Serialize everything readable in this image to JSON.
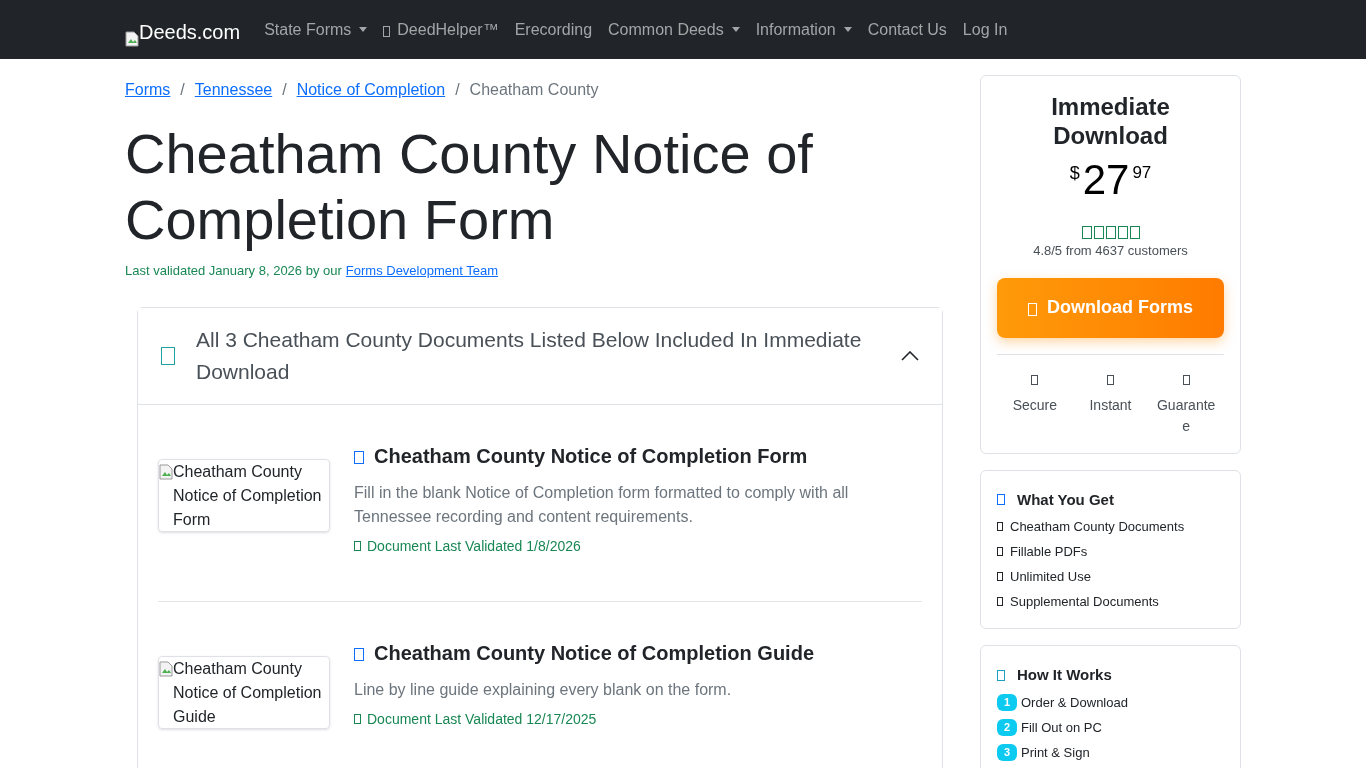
{
  "navbar": {
    "brand": "Deeds.com",
    "items": [
      {
        "label": "State Forms",
        "kind": "dropdown"
      },
      {
        "label": "DeedHelper™",
        "kind": "icon"
      },
      {
        "label": "Erecording",
        "kind": "link"
      },
      {
        "label": "Common Deeds",
        "kind": "dropdown"
      },
      {
        "label": "Information",
        "kind": "dropdown"
      },
      {
        "label": "Contact Us",
        "kind": "link"
      },
      {
        "label": "Log In",
        "kind": "link"
      }
    ]
  },
  "breadcrumb_separator": "/",
  "breadcrumb": [
    {
      "label": "Forms",
      "kind": "link"
    },
    {
      "label": "Tennessee",
      "kind": "link"
    },
    {
      "label": "Notice of Completion",
      "kind": "link"
    },
    {
      "label": "Cheatham County",
      "kind": "current"
    }
  ],
  "title": "Cheatham County Notice of Completion Form",
  "validated": {
    "text": "Last validated January 8, 2026 by our",
    "link": "Forms Development Team"
  },
  "accordion": {
    "header": "All 3 Cheatham County Documents Listed Below Included In Immediate Download",
    "expanded": true,
    "documents": [
      {
        "image_alt": "Cheatham County Notice of Completion Form",
        "title": "Cheatham County Notice of Completion Form",
        "description": "Fill in the blank Notice of Completion form formatted to comply with all Tennessee recording and content requirements.",
        "validated": "Document Last Validated 1/8/2026"
      },
      {
        "image_alt": "Cheatham County Notice of Completion Guide",
        "title": "Cheatham County Notice of Completion Guide",
        "description": "Line by line guide explaining every blank on the form.",
        "validated": "Document Last Validated 12/17/2025"
      }
    ]
  },
  "purchase": {
    "title": "Immediate Download",
    "currency": "$",
    "price": "27",
    "cents": "97",
    "rating": "4.8/5 from 4637 customers",
    "button": "Download Forms",
    "features": [
      "Secure",
      "Instant",
      "Guarante\ne"
    ]
  },
  "what_you_get": {
    "title": "What You Get",
    "items": [
      "Cheatham County Documents",
      "Fillable PDFs",
      "Unlimited Use",
      "Supplemental Documents"
    ]
  },
  "how_it_works": {
    "title": "How It Works",
    "steps": [
      {
        "number": "1",
        "label": "Order & Download"
      },
      {
        "number": "2",
        "label": "Fill Out on PC"
      },
      {
        "number": "3",
        "label": "Print & Sign"
      }
    ]
  }
}
